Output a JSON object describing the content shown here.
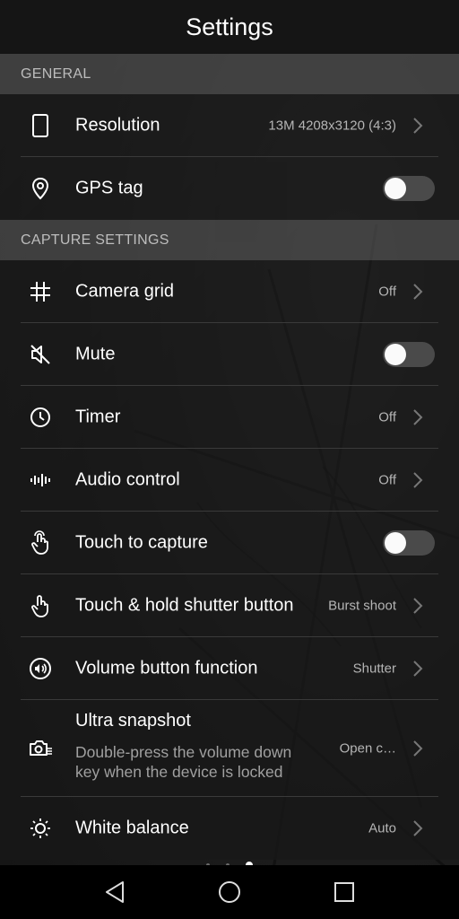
{
  "header": {
    "title": "Settings"
  },
  "sections": {
    "general": "GENERAL",
    "capture": "CAPTURE SETTINGS"
  },
  "rows": {
    "resolution": {
      "label": "Resolution",
      "value": "13M 4208x3120 (4:3)",
      "icon": "phone-outline-icon"
    },
    "gps": {
      "label": "GPS tag",
      "toggle": false,
      "icon": "location-pin-icon"
    },
    "grid": {
      "label": "Camera grid",
      "value": "Off",
      "icon": "grid-icon"
    },
    "mute": {
      "label": "Mute",
      "toggle": false,
      "icon": "speaker-muted-icon"
    },
    "timer": {
      "label": "Timer",
      "value": "Off",
      "icon": "clock-icon"
    },
    "audio": {
      "label": "Audio control",
      "value": "Off",
      "icon": "sound-wave-icon"
    },
    "touch_capture": {
      "label": "Touch to capture",
      "toggle": false,
      "icon": "hand-tap-icon"
    },
    "touch_hold": {
      "label": "Touch & hold shutter button",
      "value": "Burst shoot",
      "icon": "hand-press-icon"
    },
    "volume": {
      "label": "Volume button function",
      "value": "Shutter",
      "icon": "volume-circle-icon"
    },
    "ultra": {
      "label": "Ultra snapshot",
      "description": "Double-press the volume down key when the device is locked",
      "value": "Open c…",
      "icon": "camera-fast-icon"
    },
    "white_balance": {
      "label": "White balance",
      "value": "Auto",
      "icon": "sun-icon"
    }
  },
  "pager": {
    "count": 3,
    "active": 3
  },
  "navbar": {
    "icons": [
      "back-icon",
      "home-icon",
      "recents-icon"
    ]
  },
  "colors": {
    "background": "#1c1c1c",
    "header": "#151515",
    "section": "#444444",
    "toggle_off": "#4a4a4a"
  }
}
